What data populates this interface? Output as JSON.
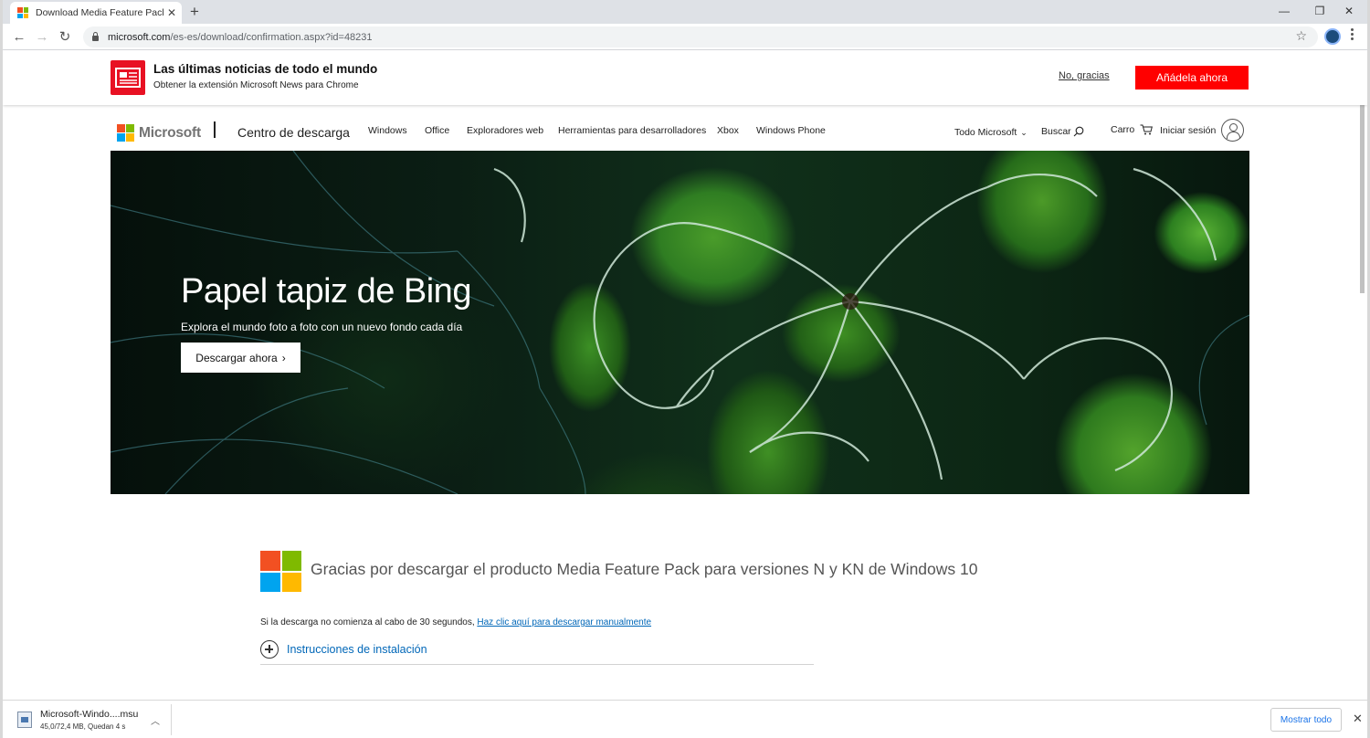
{
  "browser": {
    "tab_title": "Download Media Feature Pack p",
    "tab_close": "✕",
    "new_tab": "+",
    "url_host": "microsoft.com",
    "url_path": "/es-es/download/confirmation.aspx?id=48231",
    "window_controls": {
      "minimize": "—",
      "maximize": "❐",
      "close": "✕"
    },
    "nav": {
      "back": "←",
      "forward": "→",
      "reload": "↻"
    },
    "star": "☆"
  },
  "promo": {
    "title": "Las últimas noticias de todo el mundo",
    "subtitle": "Obtener la extensión Microsoft News para Chrome",
    "dismiss": "No, gracias",
    "add": "Añádela ahora"
  },
  "header": {
    "brand": "Microsoft",
    "section": "Centro de descarga",
    "nav": [
      "Windows",
      "Office",
      "Exploradores web",
      "Herramientas para desarrolladores",
      "Xbox",
      "Windows Phone"
    ],
    "all_microsoft": "Todo Microsoft",
    "search": "Buscar",
    "cart": "Carro",
    "signin": "Iniciar sesión"
  },
  "hero": {
    "title": "Papel tapiz de Bing",
    "subtitle": "Explora el mundo foto a foto con un nuevo fondo cada día",
    "button": "Descargar ahora"
  },
  "confirmation": {
    "message": "Gracias por descargar el producto Media Feature Pack para versiones N y KN de Windows 10",
    "retry_text": "Si la descarga no comienza al cabo de 30 segundos,",
    "retry_link": "Haz clic aquí para descargar manualmente",
    "install": "Instrucciones de instalación"
  },
  "download_shelf": {
    "file_name": "Microsoft-Windo....msu",
    "progress": "45,0/72,4 MB, Quedan 4 s",
    "progress_fraction": 0.62,
    "show_all": "Mostrar todo",
    "close": "✕"
  },
  "colors": {
    "ms_red": "#f25022",
    "ms_green": "#7fba00",
    "ms_blue": "#00a4ef",
    "ms_yellow": "#ffb900",
    "promo_red": "#ff0000",
    "link_blue": "#0067b8"
  }
}
